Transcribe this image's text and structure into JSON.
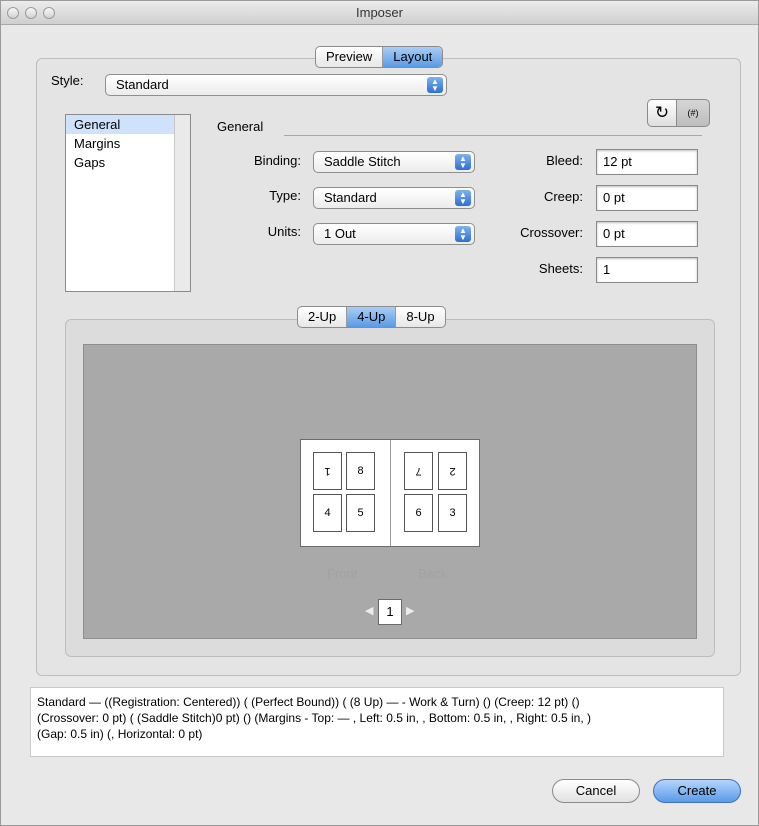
{
  "window": {
    "title": "Imposer"
  },
  "top_tabs": [
    {
      "label": "Preview",
      "selected": false
    },
    {
      "label": "Layout",
      "selected": true
    }
  ],
  "style": {
    "label": "Style:",
    "value": "Standard"
  },
  "toolbar_icons": [
    {
      "name": "reset-icon",
      "glyph": "↻"
    },
    {
      "name": "grid-icon",
      "glyph": "(#)"
    }
  ],
  "sidebar": {
    "items": [
      {
        "label": "General",
        "selected": true
      },
      {
        "label": "Margins",
        "selected": false
      },
      {
        "label": "Gaps",
        "selected": false
      }
    ]
  },
  "general": {
    "heading": "General",
    "binding": {
      "label": "Binding:",
      "value": "Saddle Stitch"
    },
    "type": {
      "label": "Type:",
      "value": "Standard"
    },
    "units": {
      "label": "Units:",
      "value": "1 Out"
    },
    "bleed": {
      "label": "Bleed:",
      "value": "12 pt"
    },
    "creep": {
      "label": "Creep:",
      "value": "0 pt"
    },
    "crossover": {
      "label": "Crossover:",
      "value": "0 pt"
    },
    "sheets": {
      "label": "Sheets:",
      "value": "1"
    }
  },
  "up_tabs": [
    {
      "label": "2-Up",
      "selected": false
    },
    {
      "label": "4-Up",
      "selected": true
    },
    {
      "label": "8-Up",
      "selected": false
    }
  ],
  "preview": {
    "front_pages": [
      "1",
      "8",
      "4",
      "5"
    ],
    "back_pages": [
      "7",
      "2",
      "6",
      "3"
    ],
    "front_label": "Front",
    "back_label": "Back",
    "page_number": "1"
  },
  "description": "Standard — ((Registration: Centered)) ( (Perfect Bound)) ( (8 Up) —  - Work & Turn) () (Creep: 12 pt) ()\n(Crossover: 0 pt) ( (Saddle Stitch)0 pt) () (Margins - Top:  — , Left: 0.5 in, , Bottom: 0.5 in, , Right: 0.5 in, )\n(Gap: 0.5 in) (, Horizontal: 0 pt)",
  "buttons": {
    "cancel": "Cancel",
    "create": "Create"
  },
  "colors": {
    "accent": "#5a9be6",
    "selection": "#cfe2fb",
    "canvas": "#a9a9a9"
  }
}
